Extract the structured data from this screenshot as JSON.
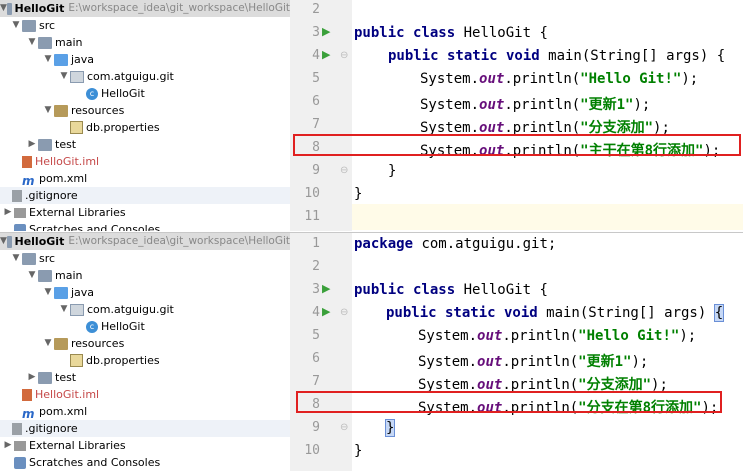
{
  "panels": [
    {
      "tree": {
        "project_name": "HelloGit",
        "project_path": "E:\\workspace_idea\\git_workspace\\HelloGit",
        "items": [
          {
            "label": "src",
            "icon": "folder-icon"
          },
          {
            "label": "main",
            "icon": "folder-icon"
          },
          {
            "label": "java",
            "icon": "source-folder-icon"
          },
          {
            "label": "com.atguigu.git",
            "icon": "package-icon"
          },
          {
            "label": "HelloGit",
            "icon": "class-icon"
          },
          {
            "label": "resources",
            "icon": "resources-folder-icon"
          },
          {
            "label": "db.properties",
            "icon": "properties-file-icon"
          },
          {
            "label": "test",
            "icon": "folder-icon"
          },
          {
            "label": "HelloGit.iml",
            "icon": "iml-file-icon"
          },
          {
            "label": "pom.xml",
            "icon": "maven-icon"
          },
          {
            "label": ".gitignore",
            "icon": "gitignore-icon"
          },
          {
            "label": "External Libraries",
            "icon": "library-icon"
          },
          {
            "label": "Scratches and Consoles",
            "icon": "scratches-icon"
          }
        ]
      },
      "line_numbers": [
        "2",
        "3",
        "4",
        "5",
        "6",
        "7",
        "8",
        "9",
        "10",
        "11"
      ],
      "code": {
        "l2": "",
        "l3_kw": "public class",
        "l3_rest": " HelloGit {",
        "l4_kw": "public static void",
        "l4_rest": " main(String[] args) {",
        "l5_a": "System.",
        "l5_f": "out",
        "l5_b": ".println(",
        "l5_s": "\"Hello Git!\"",
        "l5_c": ");",
        "l6_a": "System.",
        "l6_f": "out",
        "l6_b": ".println(",
        "l6_s": "\"更新1\"",
        "l6_c": ");",
        "l7_a": "System.",
        "l7_f": "out",
        "l7_b": ".println(",
        "l7_s": "\"分支添加\"",
        "l7_c": ");",
        "l8_a": "System.",
        "l8_f": "out",
        "l8_b": ".println(",
        "l8_s": "\"主干在第8行添加\"",
        "l8_c": ");",
        "l9": "}",
        "l10": "}",
        "l11": ""
      }
    },
    {
      "tree": {
        "project_name": "HelloGit",
        "project_path": "E:\\workspace_idea\\git_workspace\\HelloGit",
        "items": [
          {
            "label": "src",
            "icon": "folder-icon"
          },
          {
            "label": "main",
            "icon": "folder-icon"
          },
          {
            "label": "java",
            "icon": "source-folder-icon"
          },
          {
            "label": "com.atguigu.git",
            "icon": "package-icon"
          },
          {
            "label": "HelloGit",
            "icon": "class-icon"
          },
          {
            "label": "resources",
            "icon": "resources-folder-icon"
          },
          {
            "label": "db.properties",
            "icon": "properties-file-icon"
          },
          {
            "label": "test",
            "icon": "folder-icon"
          },
          {
            "label": "HelloGit.iml",
            "icon": "iml-file-icon"
          },
          {
            "label": "pom.xml",
            "icon": "maven-icon"
          },
          {
            "label": ".gitignore",
            "icon": "gitignore-icon"
          },
          {
            "label": "External Libraries",
            "icon": "library-icon"
          },
          {
            "label": "Scratches and Consoles",
            "icon": "scratches-icon"
          }
        ]
      },
      "line_numbers": [
        "1",
        "2",
        "3",
        "4",
        "5",
        "6",
        "7",
        "8",
        "9",
        "10"
      ],
      "code": {
        "l1_kw": "package",
        "l1_rest": " com.atguigu.git;",
        "l2": "",
        "l3_kw": "public class",
        "l3_rest": " HelloGit {",
        "l4_kw": "public static void",
        "l4_rest": " main(String[] args) ",
        "l4_brace": "{",
        "l5_a": "System.",
        "l5_f": "out",
        "l5_b": ".println(",
        "l5_s": "\"Hello Git!\"",
        "l5_c": ");",
        "l6_a": "System.",
        "l6_f": "out",
        "l6_b": ".println(",
        "l6_s": "\"更新1\"",
        "l6_c": ");",
        "l7_a": "System.",
        "l7_f": "out",
        "l7_b": ".println(",
        "l7_s": "\"分支添加\"",
        "l7_c": ");",
        "l8_a": "System.",
        "l8_f": "out",
        "l8_b": ".println(",
        "l8_s": "\"分支在第8行添加\"",
        "l8_c": ");",
        "l9": "}",
        "l10": "}"
      }
    }
  ],
  "colors": {
    "keyword": "#000080",
    "string": "#008000",
    "field": "#660e7a",
    "highlight_box": "#e02020",
    "run_icon": "#3aa03a"
  }
}
